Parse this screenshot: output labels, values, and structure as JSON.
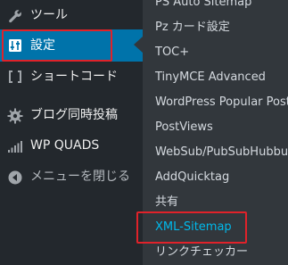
{
  "menu": {
    "items": [
      {
        "label": "ツール",
        "icon": "wrench-icon"
      },
      {
        "label": "設定",
        "icon": "settings-sliders-icon"
      },
      {
        "label": "ショートコード",
        "icon": "brackets-icon"
      },
      {
        "label": "ブログ同時投稿",
        "icon": "gear-icon"
      },
      {
        "label": "WP QUADS",
        "icon": "signal-bars-icon"
      },
      {
        "label": "メニューを閉じる",
        "icon": "collapse-arrow-icon"
      }
    ]
  },
  "submenu": {
    "items": [
      "PS Auto Sitemap",
      "Pz カード設定",
      "TOC+",
      "TinyMCE Advanced",
      "WordPress Popular Posts",
      "PostViews",
      "WebSub/PubSubHubbub",
      "AddQuicktag",
      "共有",
      "XML-Sitemap",
      "リンクチェッカー"
    ],
    "active": "XML-Sitemap"
  },
  "colors": {
    "menu_background": "#23282d",
    "submenu_background": "#32373c",
    "active_menu": "#0073aa",
    "active_link": "#00b9eb",
    "highlight_box": "#e0222a"
  }
}
